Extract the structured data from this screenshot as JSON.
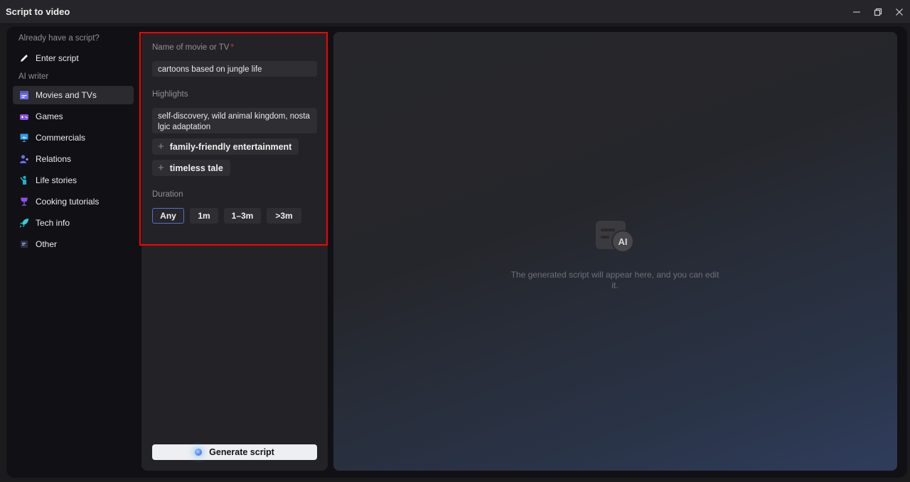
{
  "window": {
    "title": "Script to video",
    "controls": [
      "minimize",
      "restore",
      "close"
    ]
  },
  "sidebar": {
    "section_existing": "Already have a script?",
    "enter_script": "Enter script",
    "section_ai": "AI writer",
    "items": [
      {
        "label": "Movies and TVs",
        "icon": "clapperboard-icon",
        "color": "#6b6cf2",
        "active": true
      },
      {
        "label": "Games",
        "icon": "gamepad-icon",
        "color": "#8c4ee8",
        "active": false
      },
      {
        "label": "Commercials",
        "icon": "billboard-icon",
        "color": "#2f9ce8",
        "active": false
      },
      {
        "label": "Relations",
        "icon": "people-icon",
        "color": "#6b6cf2",
        "active": false
      },
      {
        "label": "Life stories",
        "icon": "person-waving-icon",
        "color": "#1fb2c6",
        "active": false
      },
      {
        "label": "Cooking tutorials",
        "icon": "goblet-icon",
        "color": "#8c4ee8",
        "active": false
      },
      {
        "label": "Tech info",
        "icon": "rocket-icon",
        "color": "#2fd0d8",
        "active": false
      },
      {
        "label": "Other",
        "icon": "note-icon",
        "color": "#2b2f4a",
        "active": false
      }
    ]
  },
  "form": {
    "name_label": "Name of movie or TV",
    "name_required_mark": "*",
    "name_value": "cartoons based on jungle life",
    "highlights_label": "Highlights",
    "highlights_value": "self-discovery, wild animal kingdom, nostalgic adaptation",
    "suggestions": [
      "family-friendly entertainment",
      "timeless tale"
    ],
    "duration_label": "Duration",
    "durations": [
      "Any",
      "1m",
      "1–3m",
      ">3m"
    ],
    "duration_selected": "Any",
    "generate_label": "Generate script"
  },
  "preview": {
    "icon_text": "AI",
    "placeholder": "The generated script will appear here, and you can edit it."
  },
  "colors": {
    "highlight_border": "#ff0000",
    "required": "#e0323c",
    "selected_border": "#5a6ad6"
  }
}
